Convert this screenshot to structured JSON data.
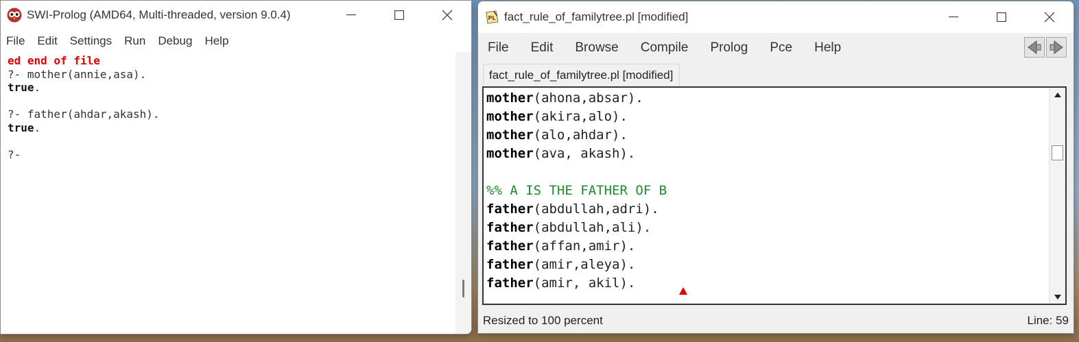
{
  "console_window": {
    "title": "SWI-Prolog (AMD64, Multi-threaded, version 9.0.4)",
    "menu": [
      "File",
      "Edit",
      "Settings",
      "Run",
      "Debug",
      "Help"
    ],
    "lines": [
      {
        "segments": [
          {
            "text": "ed end of file",
            "style": "err"
          }
        ]
      },
      {
        "segments": [
          {
            "text": "?- mother(annie,asa).",
            "style": "plain"
          }
        ]
      },
      {
        "segments": [
          {
            "text": "true",
            "style": "true"
          },
          {
            "text": ".",
            "style": "plain"
          }
        ]
      },
      {
        "segments": [
          {
            "text": "",
            "style": "plain"
          }
        ]
      },
      {
        "segments": [
          {
            "text": "?- father(ahdar,akash).",
            "style": "plain"
          }
        ]
      },
      {
        "segments": [
          {
            "text": "true",
            "style": "true"
          },
          {
            "text": ".",
            "style": "plain"
          }
        ]
      },
      {
        "segments": [
          {
            "text": "",
            "style": "plain"
          }
        ]
      },
      {
        "segments": [
          {
            "text": "?-",
            "style": "plain"
          }
        ]
      }
    ]
  },
  "editor_window": {
    "title": "fact_rule_of_familytree.pl [modified]",
    "menu": [
      "File",
      "Edit",
      "Browse",
      "Compile",
      "Prolog",
      "Pce",
      "Help"
    ],
    "tab_label": "fact_rule_of_familytree.pl [modified]",
    "code_lines": [
      {
        "kw": "mother",
        "rest": "(ahona,absar)."
      },
      {
        "kw": "mother",
        "rest": "(akira,alo)."
      },
      {
        "kw": "mother",
        "rest": "(alo,ahdar)."
      },
      {
        "kw": "mother",
        "rest": "(ava, akash)."
      },
      {
        "kw": "",
        "rest": ""
      },
      {
        "comment": "%% A IS THE FATHER OF B"
      },
      {
        "kw": "father",
        "rest": "(abdullah,adri)."
      },
      {
        "kw": "father",
        "rest": "(abdullah,ali)."
      },
      {
        "kw": "father",
        "rest": "(affan,amir)."
      },
      {
        "kw": "father",
        "rest": "(amir,aleya)."
      },
      {
        "kw": "father",
        "rest": "(amir, akil)."
      }
    ],
    "status_left": "Resized to 100 percent",
    "status_right": "Line: 59"
  },
  "colors": {
    "error_red": "#e00000",
    "comment_green": "#1e8a2c"
  },
  "icons": {
    "console_app": "swi-prolog-owl-icon",
    "editor_app": "pl-file-icon",
    "nav": [
      "back-arrow-icon",
      "forward-arrow-icon"
    ]
  }
}
